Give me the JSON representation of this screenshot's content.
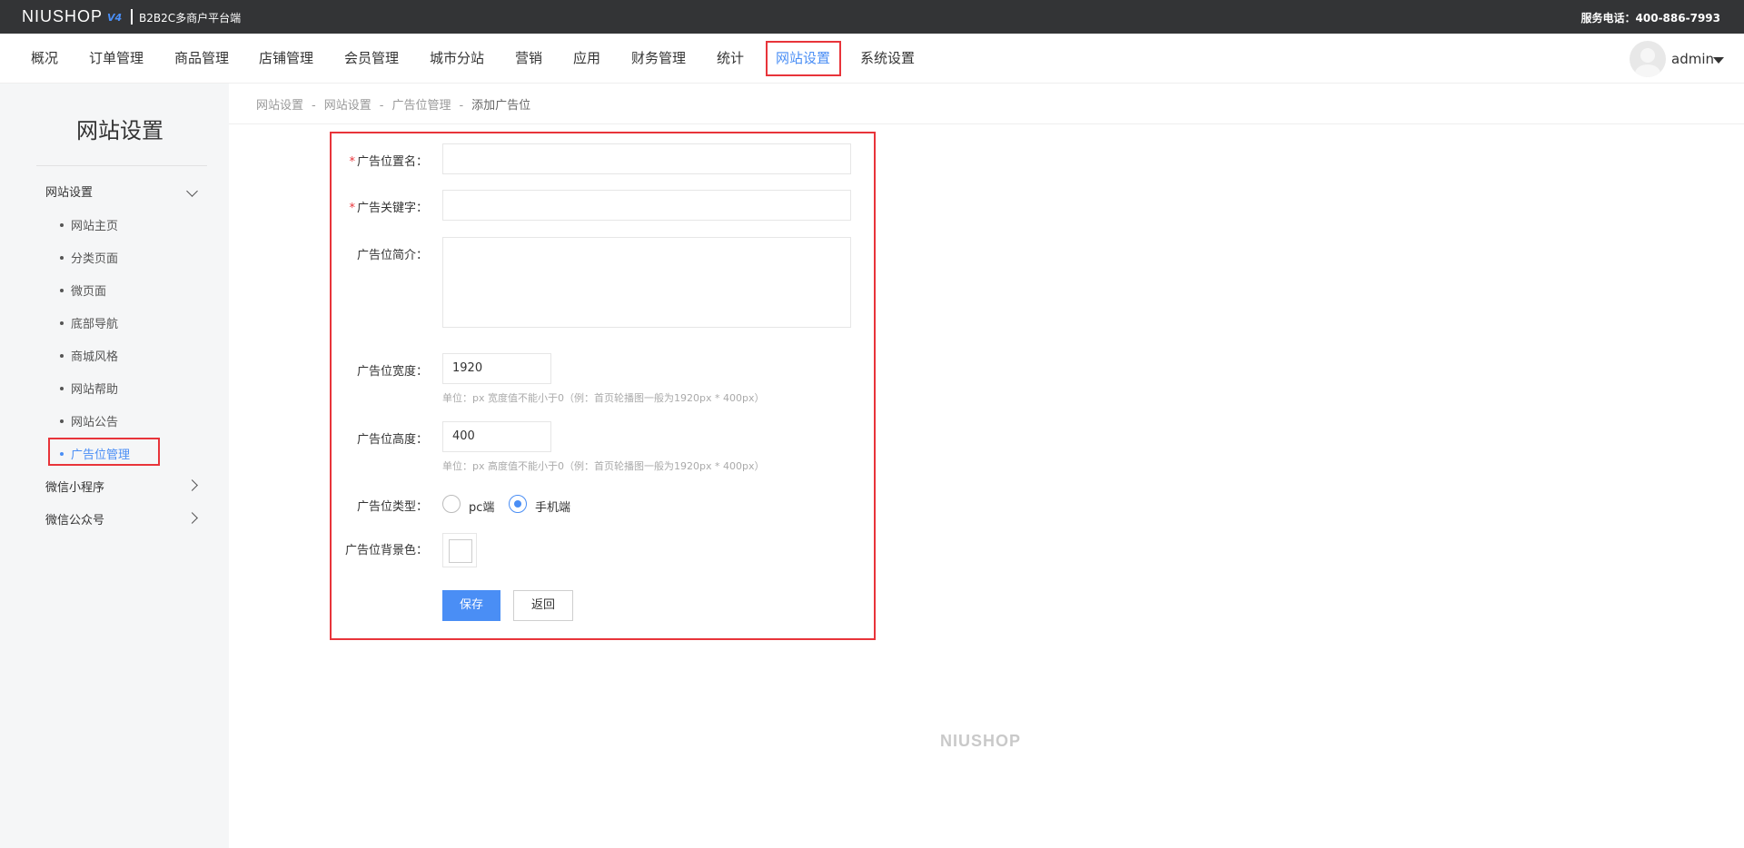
{
  "topbar": {
    "logo": "NIUSHOP",
    "logo_version": "V4",
    "platform": "B2B2C多商户平台端",
    "hotline": "服务电话：400-886-7993"
  },
  "nav": {
    "items": [
      "概况",
      "订单管理",
      "商品管理",
      "店铺管理",
      "会员管理",
      "城市分站",
      "营销",
      "应用",
      "财务管理",
      "统计",
      "网站设置",
      "系统设置"
    ],
    "active": "网站设置",
    "user": "admin"
  },
  "sidebar": {
    "title": "网站设置",
    "groups": [
      {
        "label": "网站设置",
        "expanded": true
      },
      {
        "label": "微信小程序",
        "expanded": false
      },
      {
        "label": "微信公众号",
        "expanded": false
      }
    ],
    "items": [
      "网站主页",
      "分类页面",
      "微页面",
      "底部导航",
      "商城风格",
      "网站帮助",
      "网站公告",
      "广告位管理"
    ],
    "active": "广告位管理"
  },
  "breadcrumb": {
    "items": [
      "网站设置",
      "网站设置",
      "广告位管理",
      "添加广告位"
    ],
    "separator": "-"
  },
  "form": {
    "name": {
      "label": "广告位置名：",
      "required": true,
      "value": ""
    },
    "keyword": {
      "label": "广告关键字：",
      "required": true,
      "value": ""
    },
    "intro": {
      "label": "广告位简介：",
      "value": ""
    },
    "width": {
      "label": "广告位宽度：",
      "value": "1920",
      "hint": "单位：px    宽度值不能小于0（例：首页轮播图一般为1920px * 400px）"
    },
    "height": {
      "label": "广告位高度：",
      "value": "400",
      "hint": "单位：px    高度值不能小于0（例：首页轮播图一般为1920px * 400px）"
    },
    "type": {
      "label": "广告位类型：",
      "options": [
        "pc端",
        "手机端"
      ],
      "selected": "手机端"
    },
    "bgcolor": {
      "label": "广告位背景色：",
      "value": "#ffffff"
    },
    "save_label": "保存",
    "back_label": "返回"
  },
  "footer": {
    "logo": "NIUSHOP"
  },
  "colors": {
    "accent": "#4a8ef5",
    "highlight": "#e8343a",
    "topbar": "#333436"
  }
}
